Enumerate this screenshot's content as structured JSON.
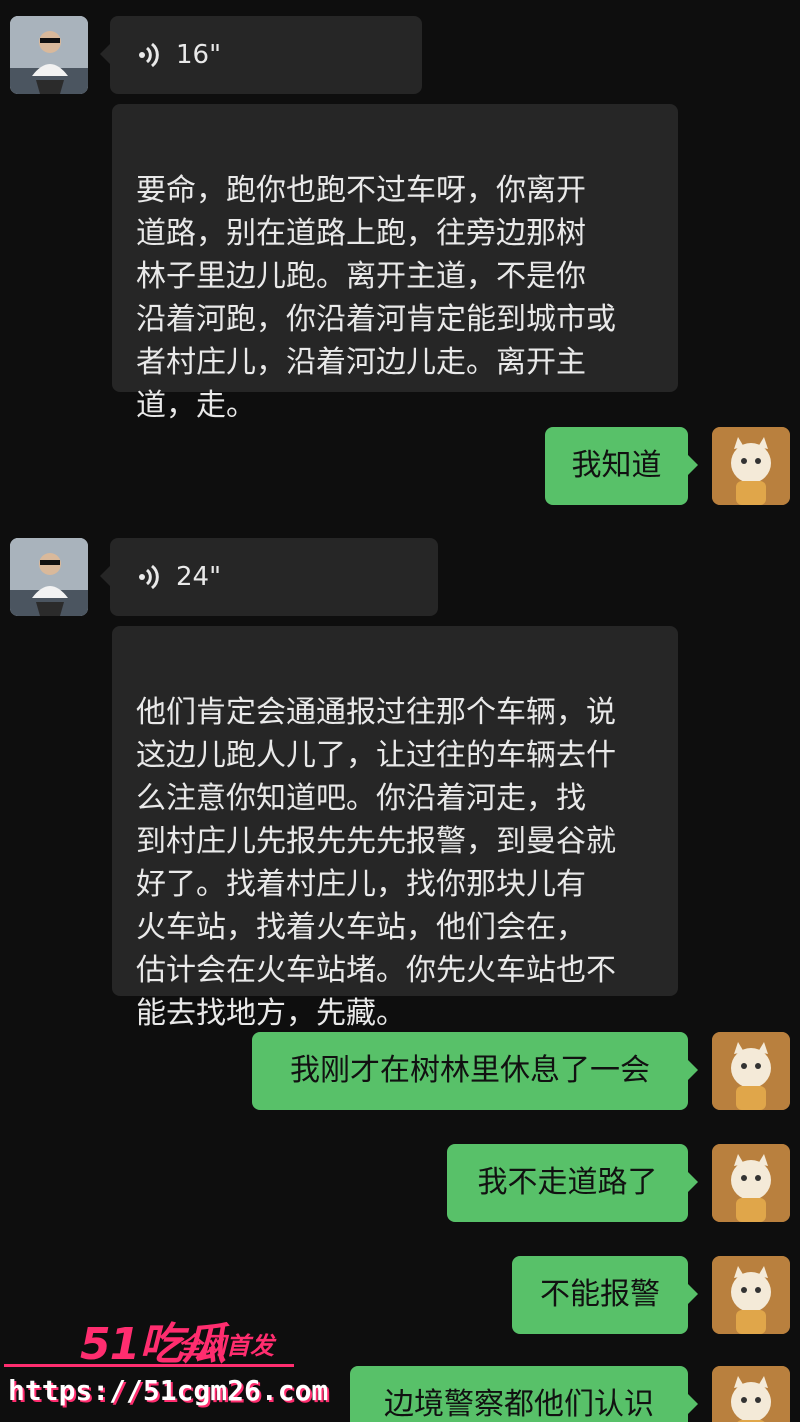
{
  "messages": [
    {
      "id": "m1",
      "side": "in",
      "type": "voice",
      "duration": "16\""
    },
    {
      "id": "m2",
      "side": "in",
      "type": "text",
      "text": "要命，跑你也跑不过车呀，你离开\n道路，别在道路上跑，往旁边那树\n林子里边儿跑。离开主道，不是你\n沿着河跑，你沿着河肯定能到城市或\n者村庄儿，沿着河边儿走。离开主\n道，走。"
    },
    {
      "id": "m3",
      "side": "out",
      "type": "text",
      "text": "我知道"
    },
    {
      "id": "m4",
      "side": "in",
      "type": "voice",
      "duration": "24\""
    },
    {
      "id": "m5",
      "side": "in",
      "type": "text",
      "text": "他们肯定会通通报过往那个车辆，说\n这边儿跑人儿了，让过往的车辆去什\n么注意你知道吧。你沿着河走，找\n到村庄儿先报先先先报警，到曼谷就\n好了。找着村庄儿，找你那块儿有\n火车站，找着火车站，他们会在，\n估计会在火车站堵。你先火车站也不\n能去找地方，先藏。"
    },
    {
      "id": "m6",
      "side": "out",
      "type": "text",
      "text": "我刚才在树林里休息了一会"
    },
    {
      "id": "m7",
      "side": "out",
      "type": "text",
      "text": "我不走道路了"
    },
    {
      "id": "m8",
      "side": "out",
      "type": "text",
      "text": "不能报警"
    },
    {
      "id": "m9",
      "side": "out",
      "type": "text",
      "text": "边境警察都他们认识"
    }
  ],
  "watermark": {
    "brand": "51吃瓜",
    "slogan": "全网首发",
    "url": "https://51cgm26.com"
  },
  "colors": {
    "background": "#0e0e0e",
    "incoming_bubble": "#262626",
    "outgoing_bubble": "#58c169",
    "watermark_accent": "#ff2d6f"
  },
  "icons": {
    "voice": "voice-wave-icon"
  }
}
